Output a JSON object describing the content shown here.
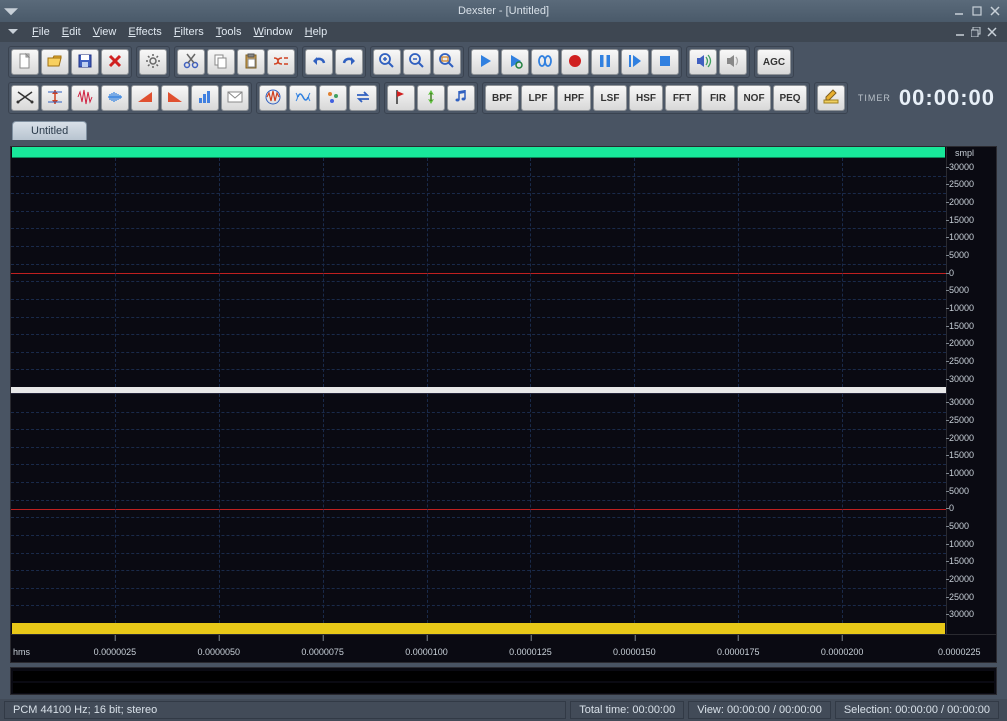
{
  "window": {
    "title": "Dexster - [Untitled]"
  },
  "menu": {
    "items": [
      "File",
      "Edit",
      "View",
      "Effects",
      "Filters",
      "Tools",
      "Window",
      "Help"
    ]
  },
  "toolbar1": {
    "groups": [
      {
        "items": [
          {
            "name": "new"
          },
          {
            "name": "open"
          },
          {
            "name": "save"
          },
          {
            "name": "delete"
          }
        ]
      },
      {
        "items": [
          {
            "name": "settings"
          }
        ]
      },
      {
        "items": [
          {
            "name": "cut"
          },
          {
            "name": "copy"
          },
          {
            "name": "paste"
          },
          {
            "name": "mix"
          }
        ]
      },
      {
        "items": [
          {
            "name": "undo"
          },
          {
            "name": "redo"
          }
        ]
      },
      {
        "items": [
          {
            "name": "zoom-in"
          },
          {
            "name": "zoom-out"
          },
          {
            "name": "zoom-fit"
          }
        ]
      },
      {
        "items": [
          {
            "name": "play"
          },
          {
            "name": "play-loop"
          },
          {
            "name": "loop"
          },
          {
            "name": "record"
          },
          {
            "name": "pause"
          },
          {
            "name": "play-section"
          },
          {
            "name": "stop"
          }
        ]
      },
      {
        "items": [
          {
            "name": "speaker"
          },
          {
            "name": "mute"
          }
        ]
      },
      {
        "items": [
          {
            "name": "agc",
            "label": "AGC"
          }
        ]
      }
    ]
  },
  "toolbar2": {
    "groups": [
      {
        "items": [
          {
            "name": "cross-fade"
          },
          {
            "name": "normalize"
          },
          {
            "name": "amplify"
          },
          {
            "name": "fade"
          },
          {
            "name": "fade-in"
          },
          {
            "name": "fade-out"
          },
          {
            "name": "chart"
          },
          {
            "name": "envelope"
          }
        ]
      },
      {
        "items": [
          {
            "name": "effect-a"
          },
          {
            "name": "effect-b"
          },
          {
            "name": "effect-c"
          },
          {
            "name": "reverse"
          }
        ]
      },
      {
        "items": [
          {
            "name": "marker"
          },
          {
            "name": "region"
          },
          {
            "name": "music"
          }
        ]
      },
      {
        "items": [
          {
            "name": "bpf",
            "label": "BPF"
          },
          {
            "name": "lpf",
            "label": "LPF"
          },
          {
            "name": "hpf",
            "label": "HPF"
          },
          {
            "name": "lsf",
            "label": "LSF"
          },
          {
            "name": "hsf",
            "label": "HSF"
          },
          {
            "name": "fft",
            "label": "FFT"
          },
          {
            "name": "fir",
            "label": "FIR"
          },
          {
            "name": "nof",
            "label": "NOF"
          },
          {
            "name": "peq",
            "label": "PEQ"
          }
        ]
      },
      {
        "items": [
          {
            "name": "edit"
          }
        ]
      }
    ],
    "timer": {
      "label": "TIMER",
      "value": "00:00:00"
    }
  },
  "tabs": [
    {
      "label": "Untitled"
    }
  ],
  "waveform": {
    "y_unit": "smpl",
    "y_ticks": [
      "30000",
      "25000",
      "20000",
      "15000",
      "10000",
      "5000",
      "0",
      "5000",
      "10000",
      "15000",
      "20000",
      "25000",
      "30000"
    ],
    "time_unit": "hms",
    "time_ticks": [
      "0.0000025",
      "0.0000050",
      "0.0000075",
      "0.0000100",
      "0.0000125",
      "0.0000150",
      "0.0000175",
      "0.0000200"
    ],
    "time_last": "0.0000225"
  },
  "status": {
    "format": "PCM 44100 Hz; 16 bit; stereo",
    "total_time_label": "Total time:",
    "total_time_value": "00:00:00",
    "view_label": "View:",
    "view_value": "00:00:00 / 00:00:00",
    "selection_label": "Selection:",
    "selection_value": "00:00:00 / 00:00:00"
  }
}
